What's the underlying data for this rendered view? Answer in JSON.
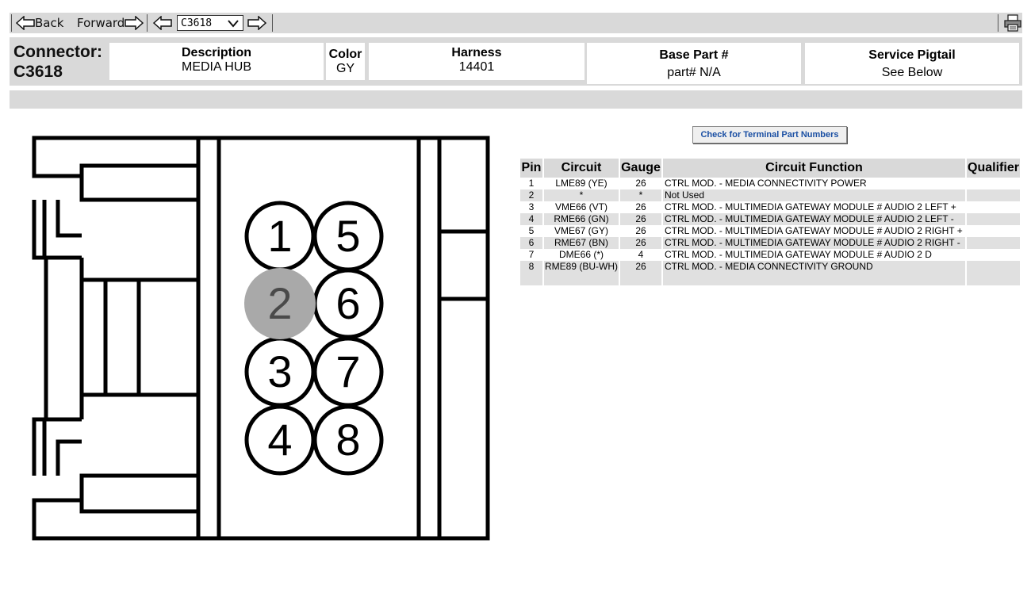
{
  "toolbar": {
    "back_label": "Back",
    "forward_label": "Forward",
    "connector_select": "C3618"
  },
  "header": {
    "connector_label": "Connector:",
    "connector_id": "C3618",
    "description_label": "Description",
    "description_value": "MEDIA HUB",
    "color_label": "Color",
    "color_value": "GY",
    "harness_label": "Harness",
    "harness_value": "14401",
    "base_part_label": "Base Part #",
    "base_part_value": "part# N/A",
    "pigtail_label": "Service Pigtail",
    "pigtail_value": "See Below"
  },
  "diagram": {
    "pins": [
      "1",
      "5",
      "2",
      "6",
      "3",
      "7",
      "4",
      "8"
    ],
    "highlighted_pin": "2"
  },
  "terminal_button": "Check for Terminal Part Numbers",
  "table": {
    "headers": [
      "Pin",
      "Circuit",
      "Gauge",
      "Circuit Function",
      "Qualifier"
    ],
    "rows": [
      {
        "pin": "1",
        "circuit": "LME89 (YE)",
        "gauge": "26",
        "function": "CTRL MOD. - MEDIA CONNECTIVITY POWER",
        "qualifier": ""
      },
      {
        "pin": "2",
        "circuit": "*",
        "gauge": "*",
        "function": "Not Used",
        "qualifier": ""
      },
      {
        "pin": "3",
        "circuit": "VME66 (VT)",
        "gauge": "26",
        "function": "CTRL MOD. - MULTIMEDIA GATEWAY MODULE # AUDIO 2 LEFT +",
        "qualifier": ""
      },
      {
        "pin": "4",
        "circuit": "RME66 (GN)",
        "gauge": "26",
        "function": "CTRL MOD. - MULTIMEDIA GATEWAY MODULE # AUDIO 2 LEFT -",
        "qualifier": ""
      },
      {
        "pin": "5",
        "circuit": "VME67 (GY)",
        "gauge": "26",
        "function": "CTRL MOD. - MULTIMEDIA GATEWAY MODULE # AUDIO 2 RIGHT +",
        "qualifier": ""
      },
      {
        "pin": "6",
        "circuit": "RME67 (BN)",
        "gauge": "26",
        "function": "CTRL MOD. - MULTIMEDIA GATEWAY MODULE # AUDIO 2 RIGHT -",
        "qualifier": ""
      },
      {
        "pin": "7",
        "circuit": "DME66 (*)",
        "gauge": "4",
        "function": "CTRL MOD. - MULTIMEDIA GATEWAY MODULE # AUDIO 2 D",
        "qualifier": ""
      },
      {
        "pin": "8",
        "circuit": "RME89 (BU-WH)",
        "gauge": "26",
        "function": "CTRL MOD. - MEDIA CONNECTIVITY GROUND",
        "qualifier": ""
      }
    ]
  }
}
